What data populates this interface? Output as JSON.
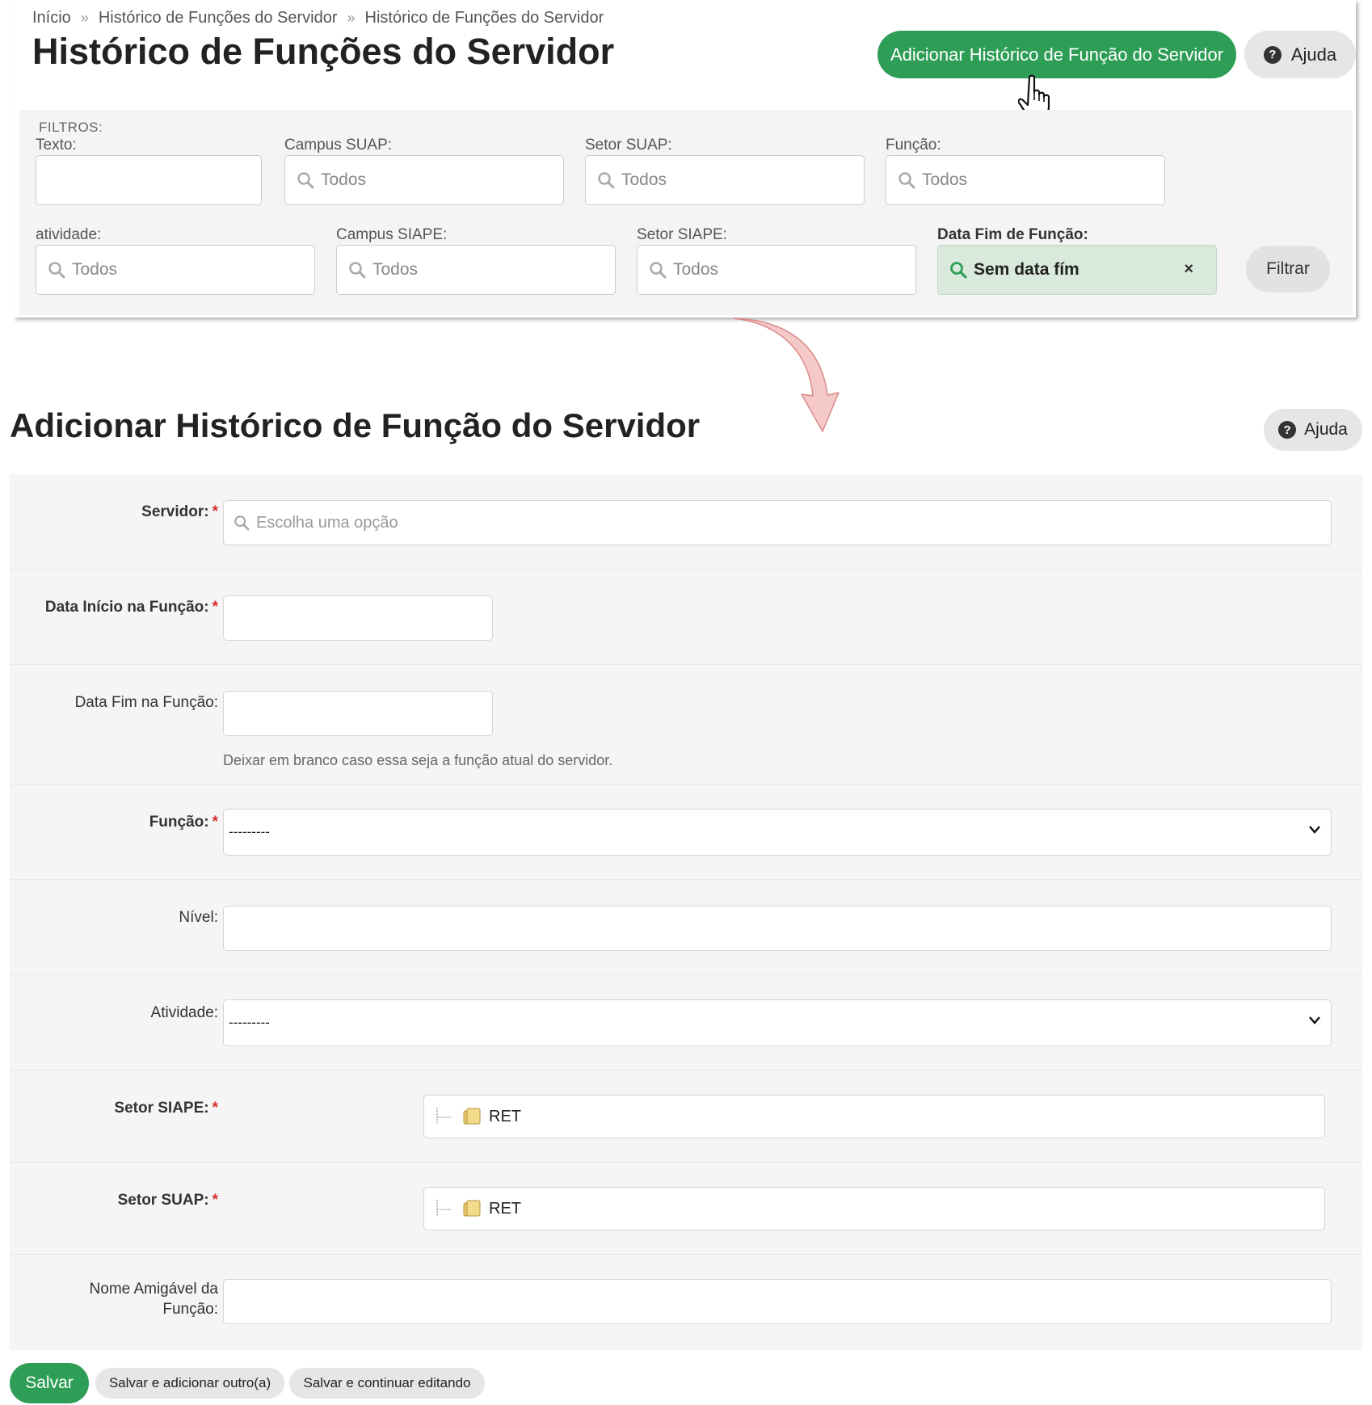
{
  "breadcrumb": {
    "items": [
      "Início",
      "Histórico de Funções do Servidor",
      "Histórico de Funções do Servidor"
    ],
    "separator": "»"
  },
  "list_page": {
    "title": "Histórico de Funções do Servidor",
    "add_button": "Adicionar Histórico de Função do Servidor",
    "help_button": "Ajuda",
    "help_icon": "question-circle-icon",
    "filters": {
      "title": "FILTROS:",
      "texto": {
        "label": "Texto:",
        "value": ""
      },
      "campus_suap": {
        "label": "Campus SUAP:",
        "value": "Todos"
      },
      "setor_suap": {
        "label": "Setor SUAP:",
        "value": "Todos"
      },
      "funcao": {
        "label": "Função:",
        "value": "Todos"
      },
      "atividade": {
        "label": "atividade:",
        "value": "Todos"
      },
      "campus_siape": {
        "label": "Campus SIAPE:",
        "value": "Todos"
      },
      "setor_siape": {
        "label": "Setor SIAPE:",
        "value": "Todos"
      },
      "data_fim": {
        "label": "Data Fim de Função:",
        "value": "Sem data fím",
        "clear": "×"
      },
      "filter_button": "Filtrar"
    }
  },
  "form_page": {
    "title": "Adicionar Histórico de Função do Servidor",
    "help_button": "Ajuda",
    "fields": {
      "servidor": {
        "label": "Servidor:",
        "required": "*",
        "placeholder": "Escolha uma opção"
      },
      "data_inicio": {
        "label": "Data Início na Função:",
        "required": "*",
        "value": ""
      },
      "data_fim": {
        "label": "Data Fim na Função:",
        "value": "",
        "help": "Deixar em branco caso essa seja a função atual do servidor."
      },
      "funcao": {
        "label": "Função:",
        "required": "*",
        "selected": "---------"
      },
      "nivel": {
        "label": "Nível:",
        "value": ""
      },
      "atividade": {
        "label": "Atividade:",
        "selected": "---------"
      },
      "setor_siape": {
        "label": "Setor SIAPE:",
        "required": "*",
        "tree_value": "RET"
      },
      "setor_suap": {
        "label": "Setor SUAP:",
        "required": "*",
        "tree_value": "RET"
      },
      "nome_amigavel": {
        "label_line1": "Nome Amigável da",
        "label_line2": "Função:",
        "value": ""
      }
    },
    "actions": {
      "save": "Salvar",
      "save_add": "Salvar e adicionar outro(a)",
      "save_continue": "Salvar e continuar editando"
    }
  },
  "colors": {
    "primary_green": "#2e9e57",
    "selected_filter_bg": "#d9eadd",
    "required_star": "#d9302c",
    "arrow_fill": "#f6c9c9",
    "arrow_stroke": "#d98a8a"
  }
}
